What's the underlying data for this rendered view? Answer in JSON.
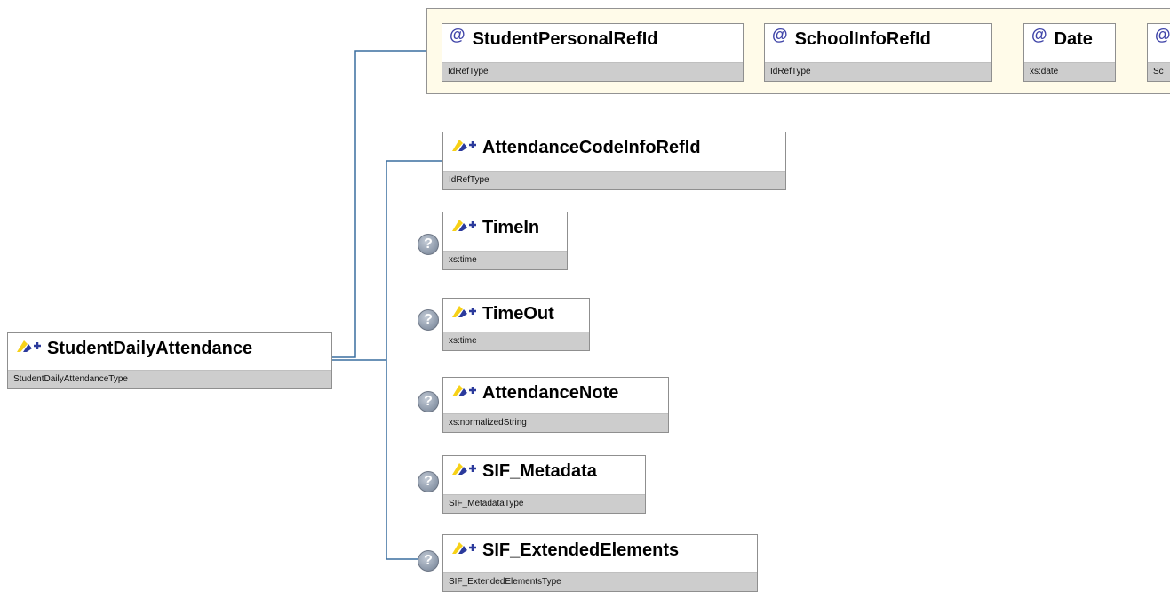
{
  "root": {
    "name": "StudentDailyAttendance",
    "type": "StudentDailyAttendanceType"
  },
  "attributes": [
    {
      "name": "StudentPersonalRefId",
      "type": "IdRefType"
    },
    {
      "name": "SchoolInfoRefId",
      "type": "IdRefType"
    },
    {
      "name": "Date",
      "type": "xs:date"
    },
    {
      "name": "",
      "type": "Sc"
    }
  ],
  "elements": [
    {
      "name": "AttendanceCodeInfoRefId",
      "type": "IdRefType",
      "optional": false
    },
    {
      "name": "TimeIn",
      "type": "xs:time",
      "optional": true
    },
    {
      "name": "TimeOut",
      "type": "xs:time",
      "optional": true
    },
    {
      "name": "AttendanceNote",
      "type": "xs:normalizedString",
      "optional": true
    },
    {
      "name": "SIF_Metadata",
      "type": "SIF_MetadataType",
      "optional": true
    },
    {
      "name": "SIF_ExtendedElements",
      "type": "SIF_ExtendedElementsType",
      "optional": true
    }
  ],
  "icons": {
    "attribute": "at-sign-icon",
    "element": "element-icon",
    "optional": "question-mark-icon"
  },
  "symbols": {
    "attribute": "@",
    "optional": "?"
  },
  "colors": {
    "connector": "#3a6e9f",
    "attribute_group_fill": "#fffbe9",
    "type_row": "#cdcdcd",
    "element_icon_yellow": "#f7d117",
    "element_icon_blue": "#2b3a9c"
  }
}
